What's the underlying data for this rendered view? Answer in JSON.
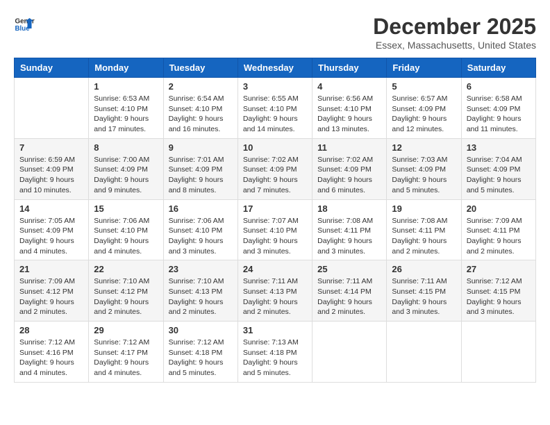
{
  "header": {
    "logo_line1": "General",
    "logo_line2": "Blue",
    "month_title": "December 2025",
    "location": "Essex, Massachusetts, United States"
  },
  "days_of_week": [
    "Sunday",
    "Monday",
    "Tuesday",
    "Wednesday",
    "Thursday",
    "Friday",
    "Saturday"
  ],
  "weeks": [
    [
      {
        "day": "",
        "info": ""
      },
      {
        "day": "1",
        "info": "Sunrise: 6:53 AM\nSunset: 4:10 PM\nDaylight: 9 hours\nand 17 minutes."
      },
      {
        "day": "2",
        "info": "Sunrise: 6:54 AM\nSunset: 4:10 PM\nDaylight: 9 hours\nand 16 minutes."
      },
      {
        "day": "3",
        "info": "Sunrise: 6:55 AM\nSunset: 4:10 PM\nDaylight: 9 hours\nand 14 minutes."
      },
      {
        "day": "4",
        "info": "Sunrise: 6:56 AM\nSunset: 4:10 PM\nDaylight: 9 hours\nand 13 minutes."
      },
      {
        "day": "5",
        "info": "Sunrise: 6:57 AM\nSunset: 4:09 PM\nDaylight: 9 hours\nand 12 minutes."
      },
      {
        "day": "6",
        "info": "Sunrise: 6:58 AM\nSunset: 4:09 PM\nDaylight: 9 hours\nand 11 minutes."
      }
    ],
    [
      {
        "day": "7",
        "info": "Sunrise: 6:59 AM\nSunset: 4:09 PM\nDaylight: 9 hours\nand 10 minutes."
      },
      {
        "day": "8",
        "info": "Sunrise: 7:00 AM\nSunset: 4:09 PM\nDaylight: 9 hours\nand 9 minutes."
      },
      {
        "day": "9",
        "info": "Sunrise: 7:01 AM\nSunset: 4:09 PM\nDaylight: 9 hours\nand 8 minutes."
      },
      {
        "day": "10",
        "info": "Sunrise: 7:02 AM\nSunset: 4:09 PM\nDaylight: 9 hours\nand 7 minutes."
      },
      {
        "day": "11",
        "info": "Sunrise: 7:02 AM\nSunset: 4:09 PM\nDaylight: 9 hours\nand 6 minutes."
      },
      {
        "day": "12",
        "info": "Sunrise: 7:03 AM\nSunset: 4:09 PM\nDaylight: 9 hours\nand 5 minutes."
      },
      {
        "day": "13",
        "info": "Sunrise: 7:04 AM\nSunset: 4:09 PM\nDaylight: 9 hours\nand 5 minutes."
      }
    ],
    [
      {
        "day": "14",
        "info": "Sunrise: 7:05 AM\nSunset: 4:09 PM\nDaylight: 9 hours\nand 4 minutes."
      },
      {
        "day": "15",
        "info": "Sunrise: 7:06 AM\nSunset: 4:10 PM\nDaylight: 9 hours\nand 4 minutes."
      },
      {
        "day": "16",
        "info": "Sunrise: 7:06 AM\nSunset: 4:10 PM\nDaylight: 9 hours\nand 3 minutes."
      },
      {
        "day": "17",
        "info": "Sunrise: 7:07 AM\nSunset: 4:10 PM\nDaylight: 9 hours\nand 3 minutes."
      },
      {
        "day": "18",
        "info": "Sunrise: 7:08 AM\nSunset: 4:11 PM\nDaylight: 9 hours\nand 3 minutes."
      },
      {
        "day": "19",
        "info": "Sunrise: 7:08 AM\nSunset: 4:11 PM\nDaylight: 9 hours\nand 2 minutes."
      },
      {
        "day": "20",
        "info": "Sunrise: 7:09 AM\nSunset: 4:11 PM\nDaylight: 9 hours\nand 2 minutes."
      }
    ],
    [
      {
        "day": "21",
        "info": "Sunrise: 7:09 AM\nSunset: 4:12 PM\nDaylight: 9 hours\nand 2 minutes."
      },
      {
        "day": "22",
        "info": "Sunrise: 7:10 AM\nSunset: 4:12 PM\nDaylight: 9 hours\nand 2 minutes."
      },
      {
        "day": "23",
        "info": "Sunrise: 7:10 AM\nSunset: 4:13 PM\nDaylight: 9 hours\nand 2 minutes."
      },
      {
        "day": "24",
        "info": "Sunrise: 7:11 AM\nSunset: 4:13 PM\nDaylight: 9 hours\nand 2 minutes."
      },
      {
        "day": "25",
        "info": "Sunrise: 7:11 AM\nSunset: 4:14 PM\nDaylight: 9 hours\nand 2 minutes."
      },
      {
        "day": "26",
        "info": "Sunrise: 7:11 AM\nSunset: 4:15 PM\nDaylight: 9 hours\nand 3 minutes."
      },
      {
        "day": "27",
        "info": "Sunrise: 7:12 AM\nSunset: 4:15 PM\nDaylight: 9 hours\nand 3 minutes."
      }
    ],
    [
      {
        "day": "28",
        "info": "Sunrise: 7:12 AM\nSunset: 4:16 PM\nDaylight: 9 hours\nand 4 minutes."
      },
      {
        "day": "29",
        "info": "Sunrise: 7:12 AM\nSunset: 4:17 PM\nDaylight: 9 hours\nand 4 minutes."
      },
      {
        "day": "30",
        "info": "Sunrise: 7:12 AM\nSunset: 4:18 PM\nDaylight: 9 hours\nand 5 minutes."
      },
      {
        "day": "31",
        "info": "Sunrise: 7:13 AM\nSunset: 4:18 PM\nDaylight: 9 hours\nand 5 minutes."
      },
      {
        "day": "",
        "info": ""
      },
      {
        "day": "",
        "info": ""
      },
      {
        "day": "",
        "info": ""
      }
    ]
  ]
}
